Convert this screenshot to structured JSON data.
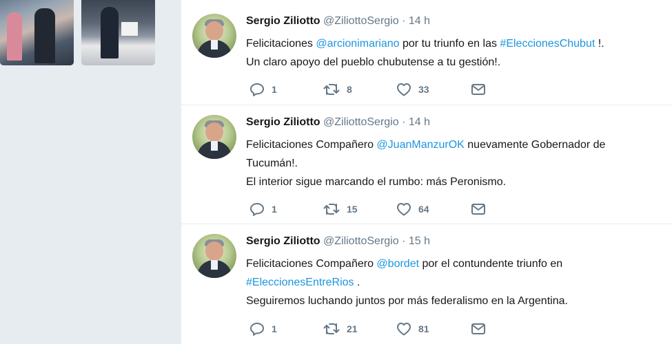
{
  "tweets": [
    {
      "name": "Sergio Ziliotto",
      "handle": "@ZiliottoSergio",
      "sep": "·",
      "time": "14 h",
      "lines": [
        [
          {
            "text": "Felicitaciones "
          },
          {
            "text": "@arcionimariano",
            "link": true
          },
          {
            "text": " por tu triunfo en las "
          },
          {
            "text": "#EleccionesChubut",
            "link": true
          },
          {
            "text": " !."
          }
        ],
        [
          {
            "text": "Un claro apoyo del pueblo chubutense a tu gestión!."
          }
        ]
      ],
      "replies": "1",
      "retweets": "8",
      "likes": "33"
    },
    {
      "name": "Sergio Ziliotto",
      "handle": "@ZiliottoSergio",
      "sep": "·",
      "time": "14 h",
      "lines": [
        [
          {
            "text": "Felicitaciones Compañero "
          },
          {
            "text": "@JuanManzurOK",
            "link": true
          },
          {
            "text": " nuevamente Gobernador de"
          }
        ],
        [
          {
            "text": "Tucumán!."
          }
        ],
        [
          {
            "text": "El interior sigue marcando el rumbo: más Peronismo."
          }
        ]
      ],
      "replies": "1",
      "retweets": "15",
      "likes": "64"
    },
    {
      "name": "Sergio Ziliotto",
      "handle": "@ZiliottoSergio",
      "sep": "·",
      "time": "15 h",
      "lines": [
        [
          {
            "text": "Felicitaciones Compañero "
          },
          {
            "text": "@bordet",
            "link": true
          },
          {
            "text": " por el contundente triunfo en"
          }
        ],
        [
          {
            "text": "#EleccionesEntreRios",
            "link": true
          },
          {
            "text": " ."
          }
        ],
        [
          {
            "text": "Seguiremos luchando juntos por más federalismo en la Argentina."
          }
        ]
      ],
      "replies": "1",
      "retweets": "21",
      "likes": "81"
    }
  ],
  "icons": {
    "reply": "reply-icon",
    "retweet": "retweet-icon",
    "like": "heart-icon",
    "message": "direct-message-icon"
  },
  "colors": {
    "link": "#1b95e0",
    "muted": "#657786",
    "text": "#14171a",
    "page_background": "#e6ecf0"
  }
}
